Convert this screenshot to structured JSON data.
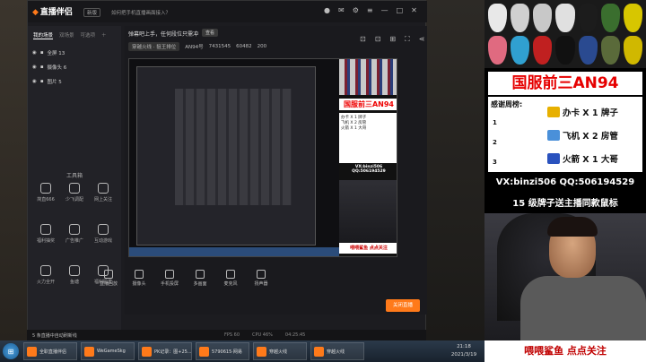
{
  "app": {
    "logo": "直播伴侣",
    "version_badge": "新版",
    "notice": "如何把手机直播画面接入？",
    "hint": "弹幕吧上手，任何段位只需冲",
    "hint_button": "查看",
    "scene_tab": "穿越火线 · 狙王排位",
    "scene_stats": [
      "AN94号",
      "7431545",
      "60482",
      "200"
    ]
  },
  "left": {
    "tabs": [
      "我的场景",
      "双场景",
      "可选项"
    ],
    "sources": [
      "全屏 13",
      "摄像头 6",
      "图片 5"
    ],
    "tools_title": "工具箱",
    "tools": [
      "简直666",
      "少飞调配",
      "网上关注",
      "福利抽奖",
      "广告推广",
      "互动游戏",
      "火力全开",
      "鱼塘",
      "福利码发"
    ]
  },
  "bottom_tools": [
    "直播回放",
    "摄像头",
    "手机投屏",
    "多画面",
    "麦克风",
    "扬声器"
  ],
  "live_button": "关闭直播",
  "status": {
    "ticker": "5 条直播中自动刷新线",
    "fps": "FPS 60",
    "cpu": "CPU 46%",
    "time": "04:25:45"
  },
  "taskbar": {
    "tasks": [
      "全职直播伴侣",
      "WeGameSkg",
      "PK记录：图+25...",
      "5790615·网易",
      "穿越火线",
      "穿越火线"
    ],
    "time": "21:18",
    "date": "2021/3/19"
  },
  "overlay": {
    "title": "国服前三AN94",
    "thanks_label": "感谢周榜:",
    "ranks": [
      "1",
      "2",
      "3"
    ],
    "prizes": [
      "办卡 X 1 牌子",
      "飞机 X 2 房管",
      "火箭 X 1 大哥"
    ],
    "prize_colors": [
      "#e7b000",
      "#4a90d9",
      "#2a52be"
    ],
    "contact": "VX:binzi506  QQ:506194529",
    "promo": "15 级牌子送主播同款鼠标",
    "footer": "喂喂鲨鱼   点点关注",
    "preview_list": [
      "办卡 X 1 牌子",
      "飞机 X 2 房管",
      "火箭 X 1 大哥"
    ],
    "preview_footer": "喂喂鲨鱼 点点关注"
  },
  "mouse_colors": [
    "#e8e8e8",
    "#d0d0d0",
    "#c8c8c8",
    "#e0e0e0",
    "#1c1c1c",
    "#3a6e2e",
    "#d7c600",
    "#e06a80",
    "#30a0d0",
    "#c02020",
    "#111111",
    "#2a4a90",
    "#5a6a3a",
    "#d0b800"
  ]
}
